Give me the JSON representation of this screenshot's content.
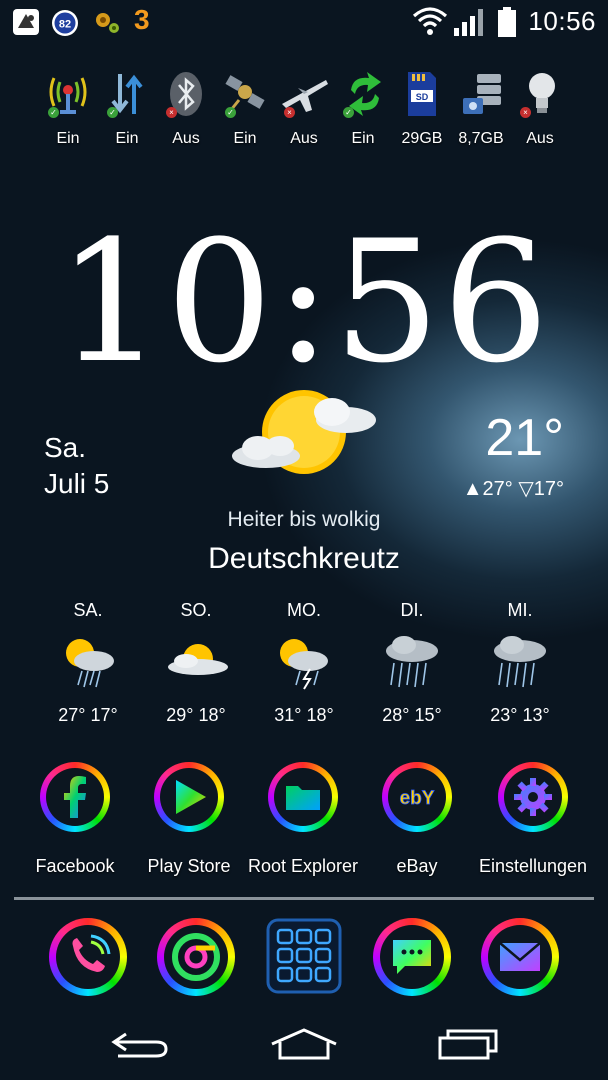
{
  "status_bar": {
    "battery_badge": "82",
    "carrier_badge": "3",
    "time": "10:56"
  },
  "quick_toggles": [
    {
      "icon": "antenna-icon",
      "label": "Ein",
      "state": "on"
    },
    {
      "icon": "data-arrows-icon",
      "label": "Ein",
      "state": "on"
    },
    {
      "icon": "bluetooth-icon",
      "label": "Aus",
      "state": "off"
    },
    {
      "icon": "gps-satellite-icon",
      "label": "Ein",
      "state": "on"
    },
    {
      "icon": "airplane-icon",
      "label": "Aus",
      "state": "off"
    },
    {
      "icon": "sync-icon",
      "label": "Ein",
      "state": "on"
    },
    {
      "icon": "sd-card-icon",
      "label": "29GB",
      "state": "none"
    },
    {
      "icon": "internal-storage-icon",
      "label": "8,7GB",
      "state": "none"
    },
    {
      "icon": "flashlight-bulb-icon",
      "label": "Aus",
      "state": "off"
    }
  ],
  "clock": {
    "time": "10:56"
  },
  "date": {
    "day": "Sa.",
    "month_day": "Juli 5"
  },
  "weather": {
    "temp_now": "21°",
    "temp_hi_lo": "▲27° ▽17°",
    "condition": "Heiter bis wolkig",
    "city": "Deutschkreutz",
    "forecast": [
      {
        "day": "SA.",
        "temps": "27°  17°",
        "icon": "sun-cloud-rain-icon"
      },
      {
        "day": "SO.",
        "temps": "29°  18°",
        "icon": "sun-cloud-icon"
      },
      {
        "day": "MO.",
        "temps": "31°  18°",
        "icon": "sun-cloud-storm-icon"
      },
      {
        "day": "DI.",
        "temps": "28°  15°",
        "icon": "rain-cloud-icon"
      },
      {
        "day": "MI.",
        "temps": "23°  13°",
        "icon": "rain-cloud-icon"
      }
    ]
  },
  "apps": [
    {
      "label": "Facebook",
      "icon": "facebook-icon"
    },
    {
      "label": "Play Store",
      "icon": "play-store-icon"
    },
    {
      "label": "Root Explorer",
      "icon": "folder-icon"
    },
    {
      "label": "eBay",
      "icon": "ebay-icon"
    },
    {
      "label": "Einstellungen",
      "icon": "settings-gear-icon"
    }
  ],
  "dock": [
    {
      "icon": "phone-icon"
    },
    {
      "icon": "chrome-icon"
    },
    {
      "icon": "app-drawer-icon"
    },
    {
      "icon": "messaging-icon"
    },
    {
      "icon": "email-icon"
    }
  ],
  "navigation": [
    "back-icon",
    "home-icon",
    "recent-apps-icon"
  ],
  "colors": {
    "accent_ring": "#ff2a2a",
    "green_badge": "#3aa13a",
    "red_badge": "#c62f2f",
    "sun": "#ffc400"
  }
}
